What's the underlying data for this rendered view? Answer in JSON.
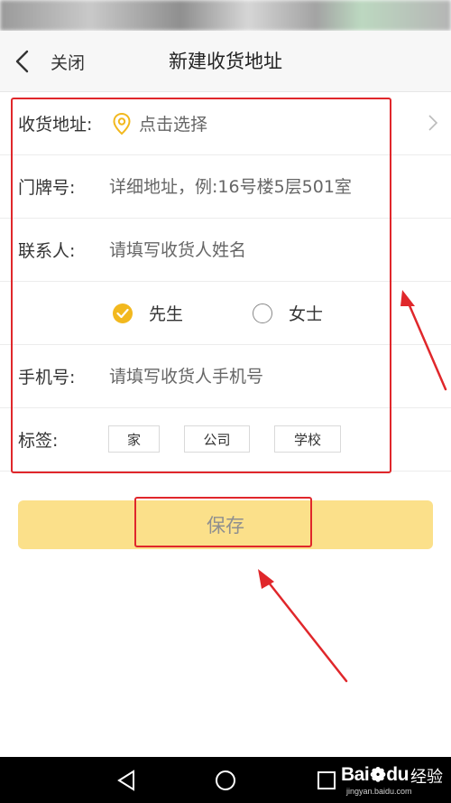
{
  "header": {
    "back_label": "关闭",
    "title": "新建收货地址"
  },
  "form": {
    "address": {
      "label": "收货地址:",
      "action": "点击选择"
    },
    "house_number": {
      "label": "门牌号:",
      "placeholder": "详细地址，例:16号楼5层501室"
    },
    "contact": {
      "label": "联系人:",
      "placeholder": "请填写收货人姓名"
    },
    "gender": {
      "options": [
        {
          "label": "先生",
          "selected": true
        },
        {
          "label": "女士",
          "selected": false
        }
      ]
    },
    "phone": {
      "label": "手机号:",
      "placeholder": "请填写收货人手机号"
    },
    "tags": {
      "label": "标签:",
      "options": [
        "家",
        "公司",
        "学校"
      ]
    }
  },
  "save_button": {
    "label": "保存"
  },
  "watermark": {
    "brand": "Bai",
    "brand_suffix": "du",
    "cn": "经验",
    "url": "jingyan.baidu.com"
  },
  "colors": {
    "accent": "#f2b81e",
    "save_bg": "#fbe08a",
    "annotation": "#e0272b"
  },
  "icons": {
    "back": "chevron-left-icon",
    "location": "location-pin-icon",
    "more": "chevron-right-icon",
    "nav_back": "triangle-back-icon",
    "nav_home": "circle-home-icon",
    "nav_recent": "square-recent-icon"
  }
}
